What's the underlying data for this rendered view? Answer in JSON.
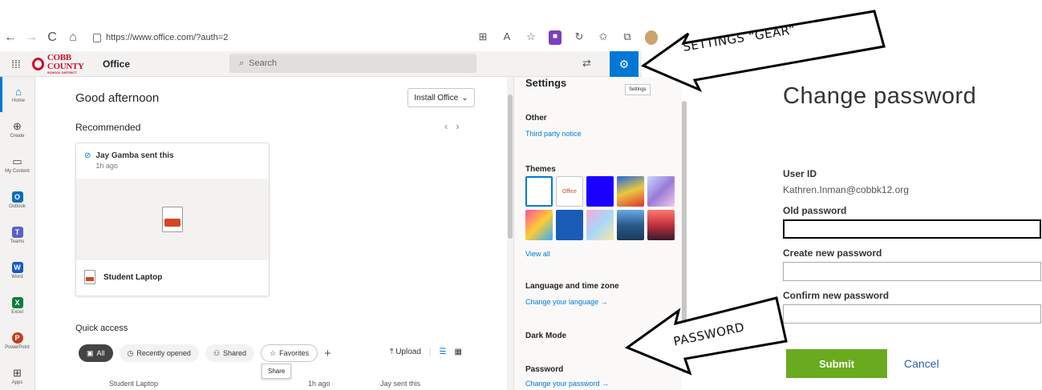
{
  "browser": {
    "url": "https://www.office.com/?auth=2",
    "nav_back": "←",
    "nav_forward": "→",
    "nav_reload": "C",
    "nav_home": "⌂"
  },
  "office_header": {
    "logo_main": "COBB COUNTY",
    "logo_sub": "SCHOOL DISTRICT",
    "app_name": "Office",
    "search_placeholder": "Search",
    "gear_tooltip": "Settings"
  },
  "rail": {
    "items": [
      {
        "label": "Home"
      },
      {
        "label": "Create"
      },
      {
        "label": "My Content"
      },
      {
        "label": "Outlook"
      },
      {
        "label": "Teams"
      },
      {
        "label": "Word"
      },
      {
        "label": "Excel"
      },
      {
        "label": "PowerPoint"
      },
      {
        "label": "Apps"
      }
    ]
  },
  "main": {
    "greeting": "Good afternoon",
    "install_label": "Install Office",
    "recommended": "Recommended",
    "card": {
      "sender": "Jay Gamba sent this",
      "time": "1h ago",
      "file_name": "Student Laptop"
    },
    "quick_access": "Quick access",
    "filters": {
      "all": "All",
      "recent": "Recently opened",
      "shared": "Shared",
      "favorites": "Favorites"
    },
    "upload_label": "Upload",
    "share_tooltip": "Share",
    "row": {
      "name": "Student Laptop",
      "time": "1h ago",
      "sender": "Jay sent this"
    }
  },
  "settings": {
    "title": "Settings",
    "other_title": "Other",
    "third_party": "Third party notice",
    "themes_title": "Themes",
    "office_theme_label": "Office",
    "view_all": "View all",
    "lang_title": "Language and time zone",
    "change_lang": "Change your language →",
    "dark_mode": "Dark Mode",
    "password_title": "Password",
    "change_password": "Change your password →"
  },
  "change_password": {
    "title": "Change password",
    "user_id_label": "User ID",
    "user_id_value": "Kathren.Inman@cobbk12.org",
    "old_label": "Old password",
    "new_label": "Create new password",
    "confirm_label": "Confirm new password",
    "submit": "Submit",
    "cancel": "Cancel"
  },
  "annotations": {
    "gear_text": "SETTINGS “GEAR”",
    "password_text": "PASSWORD"
  },
  "colors": {
    "accent": "#0078d4",
    "submit": "#6aaa1e",
    "brand_red": "#c8102e"
  }
}
